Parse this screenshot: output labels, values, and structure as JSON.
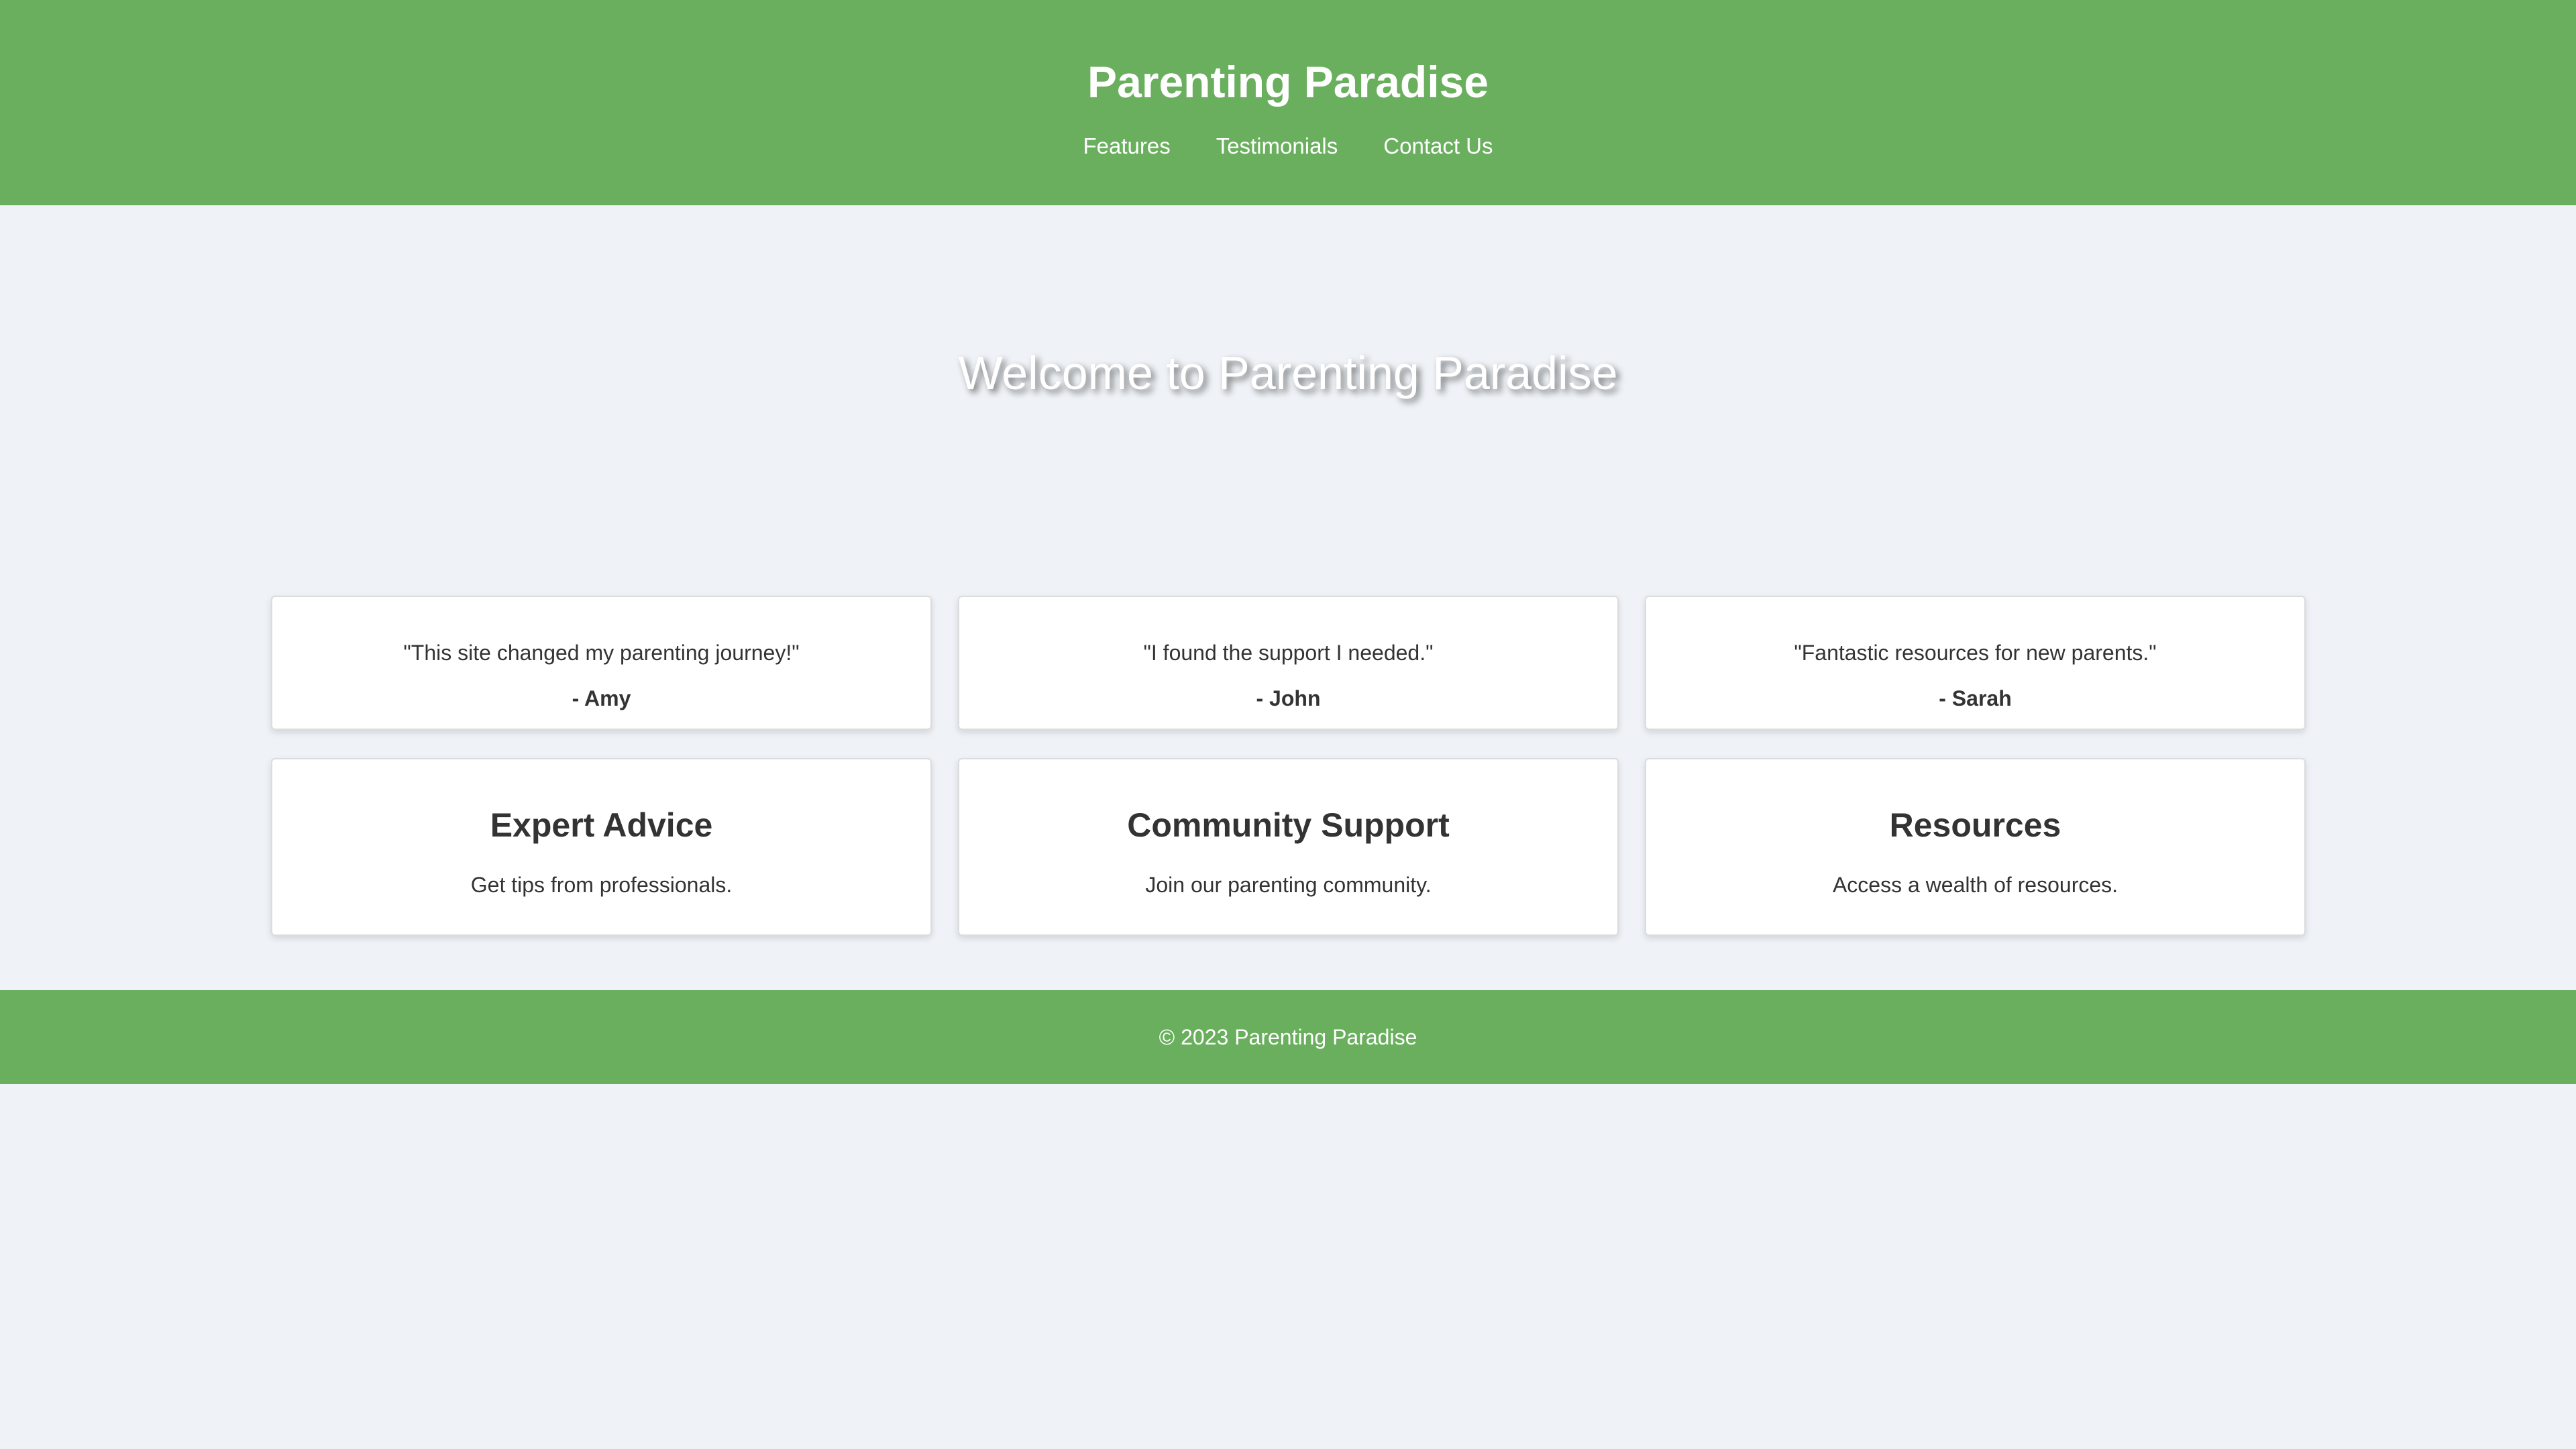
{
  "header": {
    "title": "Parenting Paradise",
    "nav": [
      {
        "label": "Features"
      },
      {
        "label": "Testimonials"
      },
      {
        "label": "Contact Us"
      }
    ]
  },
  "hero": {
    "heading": "Welcome to Parenting Paradise"
  },
  "testimonials": [
    {
      "quote": "\"This site changed my parenting journey!\"",
      "author": "- Amy"
    },
    {
      "quote": "\"I found the support I needed.\"",
      "author": "- John"
    },
    {
      "quote": "\"Fantastic resources for new parents.\"",
      "author": "- Sarah"
    }
  ],
  "features": [
    {
      "title": "Expert Advice",
      "description": "Get tips from professionals."
    },
    {
      "title": "Community Support",
      "description": "Join our parenting community."
    },
    {
      "title": "Resources",
      "description": "Access a wealth of resources."
    }
  ],
  "footer": {
    "text": "© 2023 Parenting Paradise"
  },
  "colors": {
    "header_bg": "#6aaf5e",
    "page_bg": "#eff3f7",
    "card_bg": "#ffffff",
    "text": "#333333"
  }
}
